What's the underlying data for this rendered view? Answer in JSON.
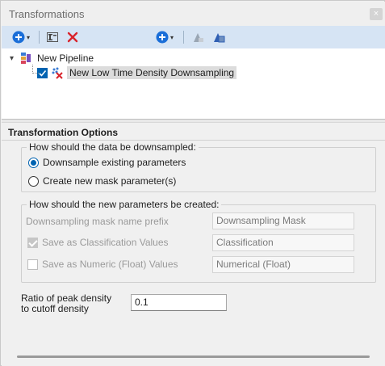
{
  "window": {
    "title": "Transformations",
    "close_glyph": "×"
  },
  "toolbar": {
    "add_icon": "add-circle-icon",
    "caret": "▾",
    "rename_icon": "rename-icon",
    "delete_icon": "delete-x-icon",
    "add2_icon": "add-circle-icon",
    "move_up_icon": "move-up-icon",
    "move_down_icon": "move-down-icon",
    "accent": "#1a6ed8"
  },
  "tree": {
    "expander": "▾",
    "root_label": "New Pipeline",
    "child_label": "New Low Time Density Downsampling",
    "child_checked": true
  },
  "options": {
    "header": "Transformation Options",
    "downsample_group": {
      "title": "How should the data be downsampled:",
      "option1": "Downsample existing parameters",
      "option2": "Create new mask parameter(s)",
      "selected": "option1"
    },
    "new_params_group": {
      "title": "How should the new parameters be created:",
      "prefix_label": "Downsampling mask name prefix",
      "prefix_value": "Downsampling Mask",
      "classification_label": "Save as Classification Values",
      "classification_checked": true,
      "classification_value": "Classification",
      "numeric_label": "Save as Numeric (Float) Values",
      "numeric_checked": false,
      "numeric_value": "Numerical (Float)"
    },
    "ratio_label_line1": "Ratio of peak density",
    "ratio_label_line2": "to cutoff density",
    "ratio_value": "0.1"
  }
}
